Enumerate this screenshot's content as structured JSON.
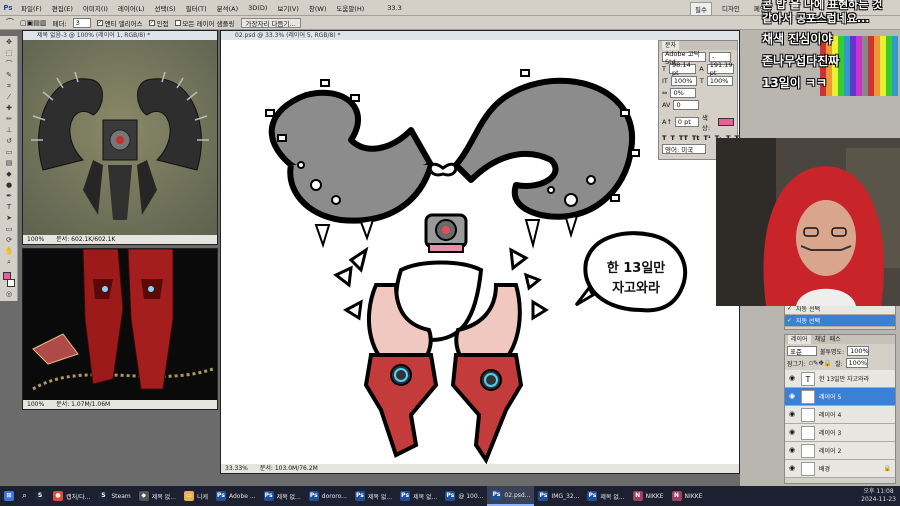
{
  "menubar": {
    "logo": "Ps",
    "items": [
      "파일(F)",
      "편집(E)",
      "이미지(I)",
      "레이어(L)",
      "선택(S)",
      "필터(T)",
      "분석(A)",
      "3D(D)",
      "보기(V)",
      "창(W)",
      "도움말(H)"
    ],
    "zoom": "33.3",
    "workspace": [
      "필수",
      "디자인",
      "페인팅"
    ]
  },
  "options": {
    "feather_label": "페더:",
    "feather_value": "3",
    "antialias_label": "앤티 앨리어스",
    "contiguous_label": "인접",
    "all_layers_label": "모든 레이어 샘플링",
    "refine_button": "가장자리 다듬기..."
  },
  "doc1": {
    "title": "제목 없음-3 @ 100% (레이어 1, RGB/8) *",
    "zoom": "100%",
    "status": "문서: 602.1K/602.1K"
  },
  "doc2": {
    "title": "",
    "zoom": "100%",
    "status": "문서: 1.07M/1.06M"
  },
  "doc3": {
    "title": "02.psd @ 33.3% (레이어 5, RGB/8) *",
    "zoom": "33.33%",
    "status": "문서: 103.0M/76.2M"
  },
  "speech_bubble": {
    "line1": "한 13일만",
    "line2": "자고와라"
  },
  "chat": {
    "line1": "콘 밥 을 나에 표현하는 것",
    "line2": "같아서 공포스럽네요...",
    "line3": "채색 진심이야",
    "line4": "존나무섭다진짜",
    "line5": "13일이 ㅋㅋ"
  },
  "character_panel": {
    "tabs": [
      "문자"
    ],
    "font": "Adobe 고딕 Std",
    "style": "-",
    "size": "98.14 pt",
    "leading": "191.19 pt",
    "scale_v": "100%",
    "scale_h": "100%",
    "tracking": "0%",
    "kerning": "0",
    "baseline": "0 pt",
    "color_label": "색상:",
    "language": "영어: 미국",
    "accent_color": "#e8609a"
  },
  "styles_panel": {
    "item1": "자동 선택",
    "item2": "자동 선택"
  },
  "layers_panel": {
    "tabs": [
      "레이어",
      "채널",
      "패스"
    ],
    "blend": "표준",
    "opacity_label": "불투명도:",
    "opacity": "100%",
    "lock_label": "잠그기:",
    "fill_label": "칠:",
    "fill": "100%",
    "layers": [
      {
        "name": "한 13일만 자고와라",
        "thumb": "T"
      },
      {
        "name": "레이어 5",
        "thumb": ""
      },
      {
        "name": "레이어 4",
        "thumb": ""
      },
      {
        "name": "레이어 3",
        "thumb": ""
      },
      {
        "name": "레이어 2",
        "thumb": ""
      },
      {
        "name": "배경",
        "thumb": ""
      }
    ]
  },
  "taskbar": {
    "items": [
      "캡처/다...",
      "Steam",
      "제목 없...",
      "니케",
      "Adobe ...",
      "제목 없...",
      "dororo...",
      "제목 없...",
      "제목 없...",
      "@ 100...",
      "02.psd...",
      "IMG_32...",
      "제목 없...",
      "NIKKE",
      "NIKKE"
    ],
    "time": "오후 11:08",
    "date": "2024-11-23"
  }
}
